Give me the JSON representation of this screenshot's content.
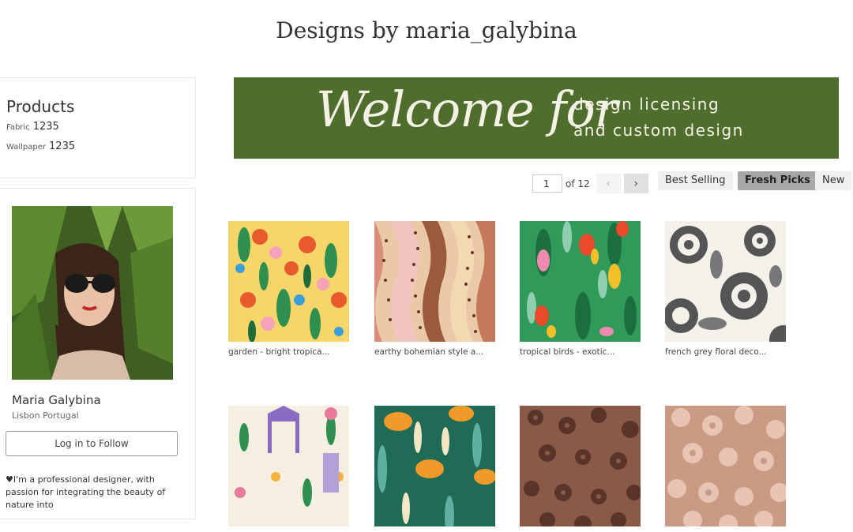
{
  "page": {
    "title": "Designs by maria_galybina"
  },
  "products": {
    "heading": "Products",
    "items": [
      {
        "label": "Fabric",
        "count": "1235"
      },
      {
        "label": "Wallpaper",
        "count": "1235"
      }
    ]
  },
  "profile": {
    "name": "Maria Galybina",
    "location": "Lisbon Portugal",
    "follow_label": "Log in to Follow",
    "bio": "♥I'm a professional designer, with passion for integrating the beauty of nature into"
  },
  "banner": {
    "script_text": "Welcome for",
    "line1": "design licensing",
    "line2": "and custom design",
    "color": "#4f6d2c"
  },
  "pagination": {
    "current": "1",
    "total_label": "of 12",
    "prev_icon": "chevron-left-icon",
    "next_icon": "chevron-right-icon"
  },
  "sort": {
    "options": [
      "Best Selling",
      "Fresh Picks",
      "New"
    ],
    "active": "Fresh Picks"
  },
  "designs": [
    {
      "caption": "garden - bright tropica..."
    },
    {
      "caption": "earthy bohemian style a..."
    },
    {
      "caption": "tropical birds - exotic..."
    },
    {
      "caption": "french grey floral deco..."
    },
    {
      "caption": ""
    },
    {
      "caption": ""
    },
    {
      "caption": ""
    },
    {
      "caption": ""
    }
  ]
}
